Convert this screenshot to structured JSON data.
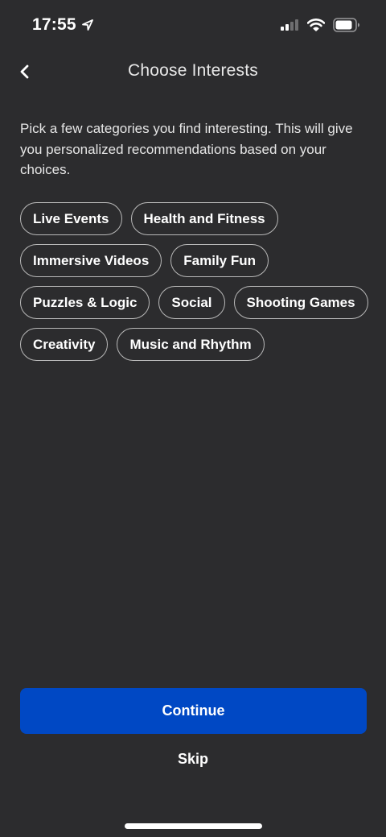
{
  "status_bar": {
    "time": "17:55",
    "icons": [
      "location-arrow-icon",
      "cellular-signal-icon",
      "wifi-icon",
      "battery-icon"
    ]
  },
  "header": {
    "back_icon": "chevron-left-icon",
    "title": "Choose Interests"
  },
  "description": "Pick a few categories you find interesting. This will give you personalized recommendations based on your choices.",
  "interests": [
    "Live Events",
    "Health and Fitness",
    "Immersive Videos",
    "Family Fun",
    "Puzzles & Logic",
    "Social",
    "Shooting Games",
    "Creativity",
    "Music and Rhythm"
  ],
  "actions": {
    "continue_label": "Continue",
    "skip_label": "Skip"
  },
  "colors": {
    "background": "#2c2c2e",
    "primary_button": "#0048c4",
    "chip_border": "#b8b8b8"
  }
}
